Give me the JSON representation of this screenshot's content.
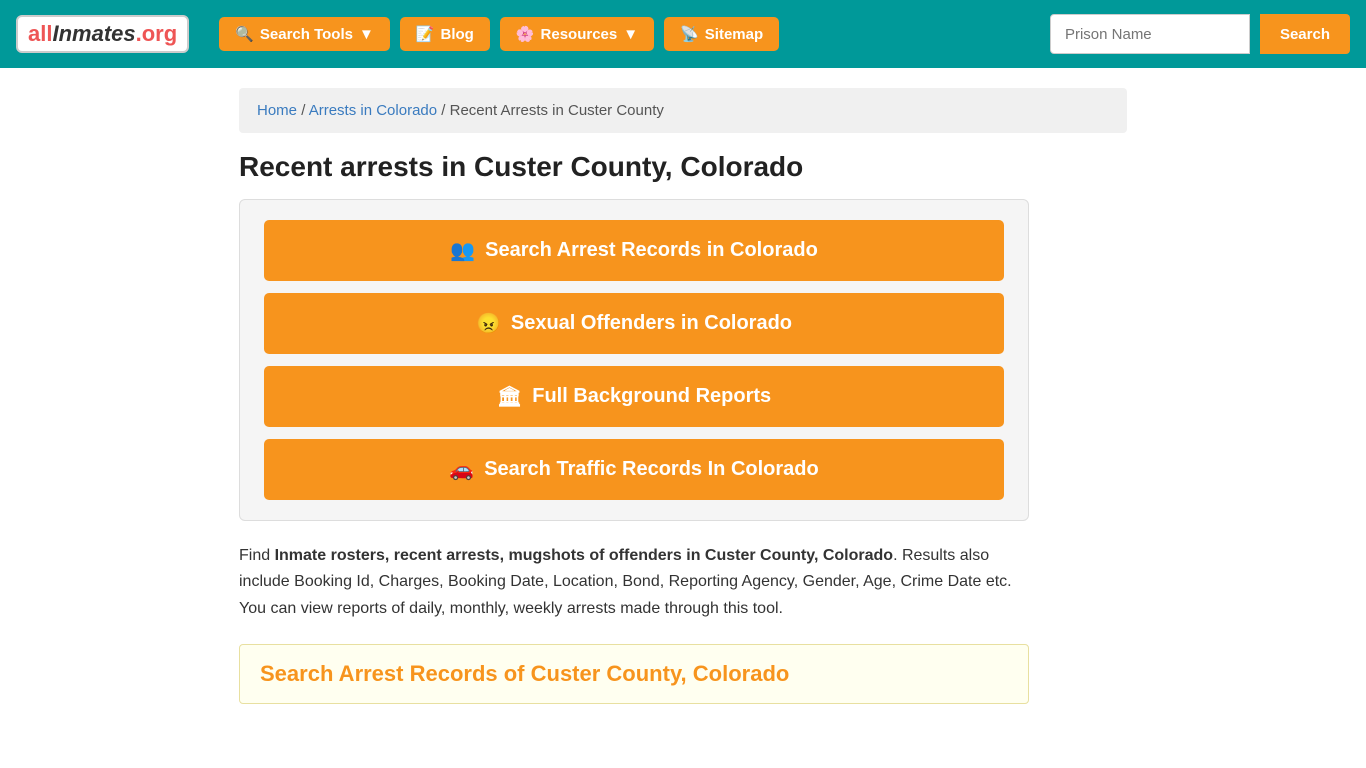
{
  "logo": {
    "all": "all",
    "inmates": "Inmates",
    "org": ".org"
  },
  "nav": {
    "search_tools": "Search Tools",
    "blog": "Blog",
    "resources": "Resources",
    "sitemap": "Sitemap",
    "prison_placeholder": "Prison Name",
    "search_btn": "Search"
  },
  "breadcrumb": {
    "home": "Home",
    "arrests": "Arrests in Colorado",
    "current": "Recent Arrests in Custer County"
  },
  "page": {
    "title": "Recent arrests in Custer County, Colorado"
  },
  "buttons": {
    "arrest_records": "Search Arrest Records in Colorado",
    "sexual_offenders": "Sexual Offenders in Colorado",
    "background_reports": "Full Background Reports",
    "traffic_records": "Search Traffic Records In Colorado"
  },
  "description": {
    "intro": "Find ",
    "bold_text": "Inmate rosters, recent arrests, mugshots of offenders in Custer County, Colorado",
    "rest": ". Results also include Booking Id, Charges, Booking Date, Location, Bond, Reporting Agency, Gender, Age, Crime Date etc. You can view reports of daily, monthly, weekly arrests made through this tool."
  },
  "section": {
    "heading": "Search Arrest Records of Custer County, Colorado"
  },
  "icons": {
    "search_tools": "🔍",
    "blog": "📝",
    "resources": "🌸",
    "sitemap": "📡",
    "arrest_records": "👥",
    "sexual_offenders": "😠",
    "background_reports": "🏛",
    "traffic_records": "🚗"
  }
}
